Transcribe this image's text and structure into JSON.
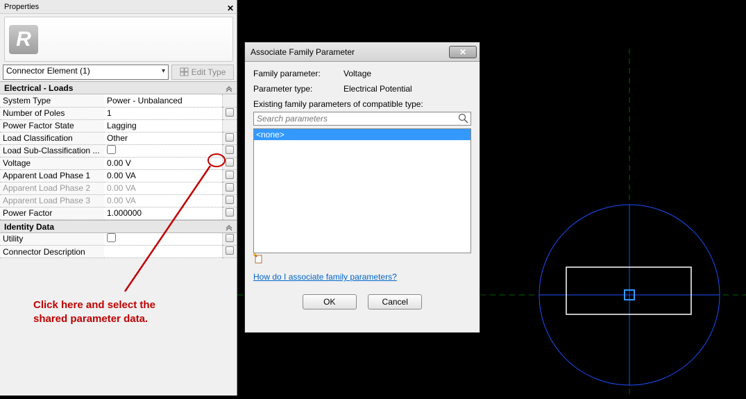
{
  "properties": {
    "panel_title": "Properties",
    "type_selector": "Connector Element (1)",
    "edit_type_label": "Edit Type",
    "groups": [
      {
        "name": "Electrical - Loads",
        "rows": [
          {
            "label": "System Type",
            "value": "Power - Unbalanced",
            "assoc": false,
            "disabled": false
          },
          {
            "label": "Number of Poles",
            "value": "1",
            "assoc": true,
            "disabled": false
          },
          {
            "label": "Power Factor State",
            "value": "Lagging",
            "assoc": false,
            "disabled": false
          },
          {
            "label": "Load Classification",
            "value": "Other",
            "assoc": true,
            "disabled": false
          },
          {
            "label": "Load Sub-Classification ...",
            "value": "",
            "assoc": true,
            "checkbox": true,
            "disabled": false
          },
          {
            "label": "Voltage",
            "value": "0.00 V",
            "assoc": true,
            "disabled": false
          },
          {
            "label": "Apparent Load Phase 1",
            "value": "0.00 VA",
            "assoc": true,
            "disabled": false
          },
          {
            "label": "Apparent Load Phase 2",
            "value": "0.00 VA",
            "assoc": true,
            "disabled": true
          },
          {
            "label": "Apparent Load Phase 3",
            "value": "0.00 VA",
            "assoc": true,
            "disabled": true
          },
          {
            "label": "Power Factor",
            "value": "1.000000",
            "assoc": true,
            "disabled": false
          }
        ]
      },
      {
        "name": "Identity Data",
        "rows": [
          {
            "label": "Utility",
            "value": "",
            "assoc": true,
            "checkbox": true,
            "disabled": false
          },
          {
            "label": "Connector Description",
            "value": "",
            "assoc": true,
            "disabled": false
          }
        ]
      }
    ]
  },
  "annotation": {
    "line1": "Click here and select the",
    "line2": "shared parameter data."
  },
  "dialog": {
    "title": "Associate Family Parameter",
    "family_param_label": "Family parameter:",
    "family_param_value": "Voltage",
    "param_type_label": "Parameter type:",
    "param_type_value": "Electrical Potential",
    "existing_label": "Existing family parameters of compatible type:",
    "search_placeholder": "Search parameters",
    "list_item_none": "<none>",
    "help_link": "How do I associate family parameters?",
    "ok": "OK",
    "cancel": "Cancel"
  }
}
